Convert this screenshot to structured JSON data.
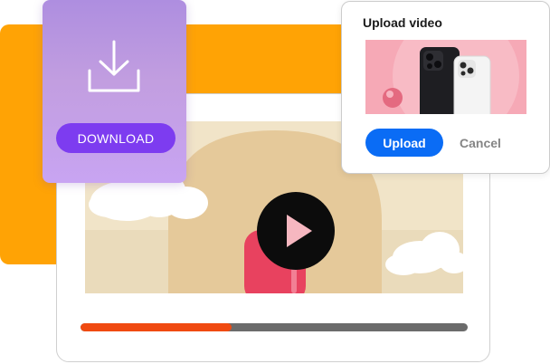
{
  "download_card": {
    "icon": "download-icon",
    "button_label": "DOWNLOAD"
  },
  "upload_dialog": {
    "title": "Upload video",
    "upload_label": "Upload",
    "cancel_label": "Cancel"
  },
  "player": {
    "play_icon": "play-icon",
    "progress_fraction": 0.39
  },
  "colors": {
    "orange_accent": "#FFA305",
    "download_button": "#7D3CF0",
    "upload_button": "#0A6CF5",
    "progress_fill": "#F04A11",
    "progress_track": "#6b6b6b"
  }
}
